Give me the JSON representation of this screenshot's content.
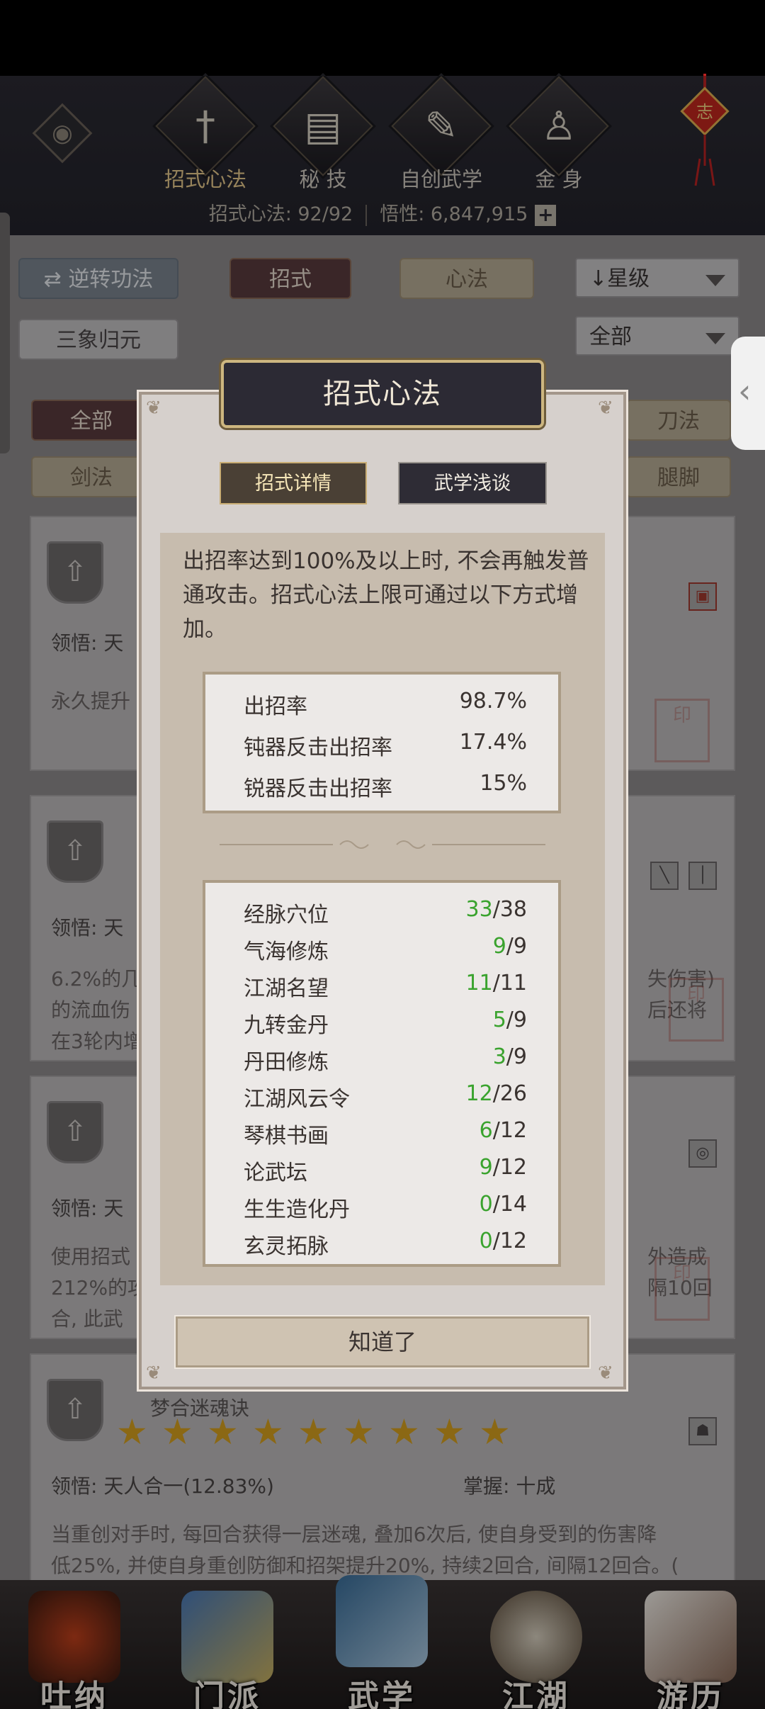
{
  "top_nav": {
    "items": [
      {
        "label": "招式心法",
        "icon": "sword-icon",
        "active": true
      },
      {
        "label": "秘 技",
        "icon": "book-icon",
        "active": false
      },
      {
        "label": "自创武学",
        "icon": "scroll-icon",
        "active": false
      },
      {
        "label": "金 身",
        "icon": "meditation-icon",
        "active": false
      }
    ],
    "stats": {
      "moves": "招式心法: 92/92",
      "insight": "悟性: 6,847,915",
      "plus": "+"
    }
  },
  "filters": {
    "reverse_button": "逆转功法",
    "tab_moves": "招式",
    "tab_mind": "心法",
    "sort_dropdown": "星级",
    "sanxiang": "三象归元",
    "all_dropdown": "全部",
    "category_all": "全部",
    "category_sword": "剑法",
    "category_blade": "刀法",
    "category_leg": "腿脚"
  },
  "background_cards": [
    {
      "comprehension": "领悟: 天",
      "desc": "永久提升"
    },
    {
      "comprehension": "领悟: 天",
      "desc_lines": [
        "6.2%的几",
        "的流血伤",
        "在3轮内增"
      ],
      "desc_right": [
        "失伤害)",
        "后还将"
      ]
    },
    {
      "comprehension": "领悟: 天",
      "desc_lines": [
        "使用招式",
        "212%的攻",
        "合, 此武"
      ],
      "desc_right": [
        "外造成",
        "隔10回"
      ]
    },
    {
      "name_fragment": "梦合迷魂诀",
      "comprehension": "领悟: 天人合一(12.83%)",
      "mastery": "掌握: 十成",
      "desc_lines": [
        "当重创对手时, 每回合获得一层迷魂, 叠加6次后, 使自身受到的伤害降",
        "低25%, 并使自身重创防御和招架提升20%, 持续2回合, 间隔12回合。("
      ],
      "stars": 9
    }
  ],
  "modal": {
    "title": "招式心法",
    "tabs": [
      "招式详情",
      "武学浅谈"
    ],
    "description": "出招率达到100%及以上时, 不会再触发普通攻击。招式心法上限可通过以下方式增加。",
    "rates": [
      {
        "label": "出招率",
        "value": "98.7%"
      },
      {
        "label": "钝器反击出招率",
        "value": "17.4%"
      },
      {
        "label": "锐器反击出招率",
        "value": "15%"
      }
    ],
    "sources": [
      {
        "label": "经脉穴位",
        "current": "33",
        "max": "/38"
      },
      {
        "label": "气海修炼",
        "current": "9",
        "max": "/9"
      },
      {
        "label": "江湖名望",
        "current": "11",
        "max": "/11"
      },
      {
        "label": "九转金丹",
        "current": "5",
        "max": "/9"
      },
      {
        "label": "丹田修炼",
        "current": "3",
        "max": "/9"
      },
      {
        "label": "江湖风云令",
        "current": "12",
        "max": "/26"
      },
      {
        "label": "琴棋书画",
        "current": "6",
        "max": "/12"
      },
      {
        "label": "论武坛",
        "current": "9",
        "max": "/12"
      },
      {
        "label": "生生造化丹",
        "current": "0",
        "max": "/14"
      },
      {
        "label": "玄灵拓脉",
        "current": "0",
        "max": "/12"
      }
    ],
    "ok_button": "知道了"
  },
  "bottom_nav": [
    {
      "label": "吐纳"
    },
    {
      "label": "门派"
    },
    {
      "label": "武学"
    },
    {
      "label": "江湖"
    },
    {
      "label": "游历"
    }
  ],
  "colors": {
    "accent_green": "#3aa32e",
    "gold": "#cdb680",
    "modal_header": "#2c2a34"
  }
}
